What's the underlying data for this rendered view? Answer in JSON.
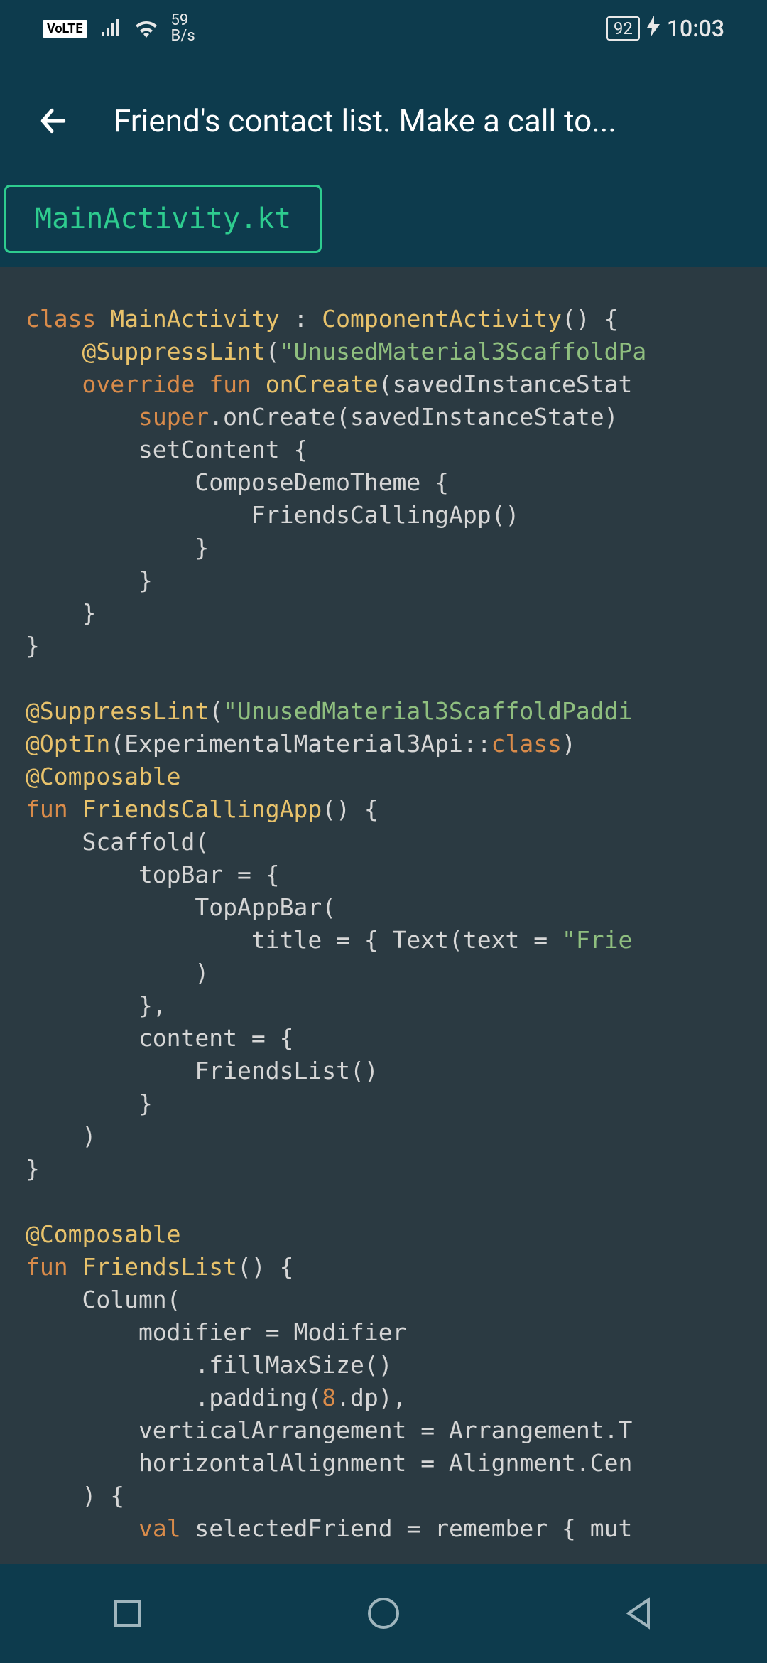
{
  "status": {
    "volte": "VoLTE",
    "net_speed_top": "59",
    "net_speed_bottom": "B/s",
    "battery": "92",
    "clock": "10:03"
  },
  "header": {
    "title": "Friend's contact list. Make a call to..."
  },
  "tab": {
    "label": "MainActivity.kt"
  },
  "code_tokens": [
    [
      [
        "kw",
        "class"
      ],
      [
        "pun",
        " "
      ],
      [
        "type",
        "MainActivity"
      ],
      [
        "pun",
        " : "
      ],
      [
        "type",
        "ComponentActivity"
      ],
      [
        "pun",
        "() {"
      ]
    ],
    [
      [
        "pun",
        "    "
      ],
      [
        "type",
        "@SuppressLint"
      ],
      [
        "pun",
        "("
      ],
      [
        "str",
        "\"UnusedMaterial3ScaffoldPa"
      ]
    ],
    [
      [
        "pun",
        "    "
      ],
      [
        "kw",
        "override"
      ],
      [
        "pun",
        " "
      ],
      [
        "kw",
        "fun"
      ],
      [
        "pun",
        " "
      ],
      [
        "name",
        "onCreate"
      ],
      [
        "pun",
        "(savedInstanceStat"
      ]
    ],
    [
      [
        "pun",
        "        "
      ],
      [
        "kw",
        "super"
      ],
      [
        "pun",
        ".onCreate(savedInstanceState)"
      ]
    ],
    [
      [
        "pun",
        "        setContent {"
      ]
    ],
    [
      [
        "pun",
        "            ComposeDemoTheme {"
      ]
    ],
    [
      [
        "pun",
        "                FriendsCallingApp()"
      ]
    ],
    [
      [
        "pun",
        "            }"
      ]
    ],
    [
      [
        "pun",
        "        }"
      ]
    ],
    [
      [
        "pun",
        "    }"
      ]
    ],
    [
      [
        "pun",
        "}"
      ]
    ],
    [
      [
        "pun",
        ""
      ]
    ],
    [
      [
        "type",
        "@SuppressLint"
      ],
      [
        "pun",
        "("
      ],
      [
        "str",
        "\"UnusedMaterial3ScaffoldPaddi"
      ]
    ],
    [
      [
        "type",
        "@OptIn"
      ],
      [
        "pun",
        "(ExperimentalMaterial3Api::"
      ],
      [
        "kw",
        "class"
      ],
      [
        "pun",
        ")"
      ]
    ],
    [
      [
        "type",
        "@Composable"
      ]
    ],
    [
      [
        "kw",
        "fun"
      ],
      [
        "pun",
        " "
      ],
      [
        "name",
        "FriendsCallingApp"
      ],
      [
        "pun",
        "() {"
      ]
    ],
    [
      [
        "pun",
        "    Scaffold("
      ]
    ],
    [
      [
        "pun",
        "        topBar = {"
      ]
    ],
    [
      [
        "pun",
        "            TopAppBar("
      ]
    ],
    [
      [
        "pun",
        "                title = { Text(text = "
      ],
      [
        "str",
        "\"Frie"
      ]
    ],
    [
      [
        "pun",
        "            )"
      ]
    ],
    [
      [
        "pun",
        "        },"
      ]
    ],
    [
      [
        "pun",
        "        content = {"
      ]
    ],
    [
      [
        "pun",
        "            FriendsList()"
      ]
    ],
    [
      [
        "pun",
        "        }"
      ]
    ],
    [
      [
        "pun",
        "    )"
      ]
    ],
    [
      [
        "pun",
        "}"
      ]
    ],
    [
      [
        "pun",
        ""
      ]
    ],
    [
      [
        "type",
        "@Composable"
      ]
    ],
    [
      [
        "kw",
        "fun"
      ],
      [
        "pun",
        " "
      ],
      [
        "name",
        "FriendsList"
      ],
      [
        "pun",
        "() {"
      ]
    ],
    [
      [
        "pun",
        "    Column("
      ]
    ],
    [
      [
        "pun",
        "        modifier = Modifier"
      ]
    ],
    [
      [
        "pun",
        "            .fillMaxSize()"
      ]
    ],
    [
      [
        "pun",
        "            .padding("
      ],
      [
        "num",
        "8"
      ],
      [
        "pun",
        ".dp),"
      ]
    ],
    [
      [
        "pun",
        "        verticalArrangement = Arrangement.T"
      ]
    ],
    [
      [
        "pun",
        "        horizontalAlignment = Alignment.Cen"
      ]
    ],
    [
      [
        "pun",
        "    ) {"
      ]
    ],
    [
      [
        "pun",
        "        "
      ],
      [
        "kw",
        "val"
      ],
      [
        "pun",
        " selectedFriend = remember { mut"
      ]
    ]
  ]
}
